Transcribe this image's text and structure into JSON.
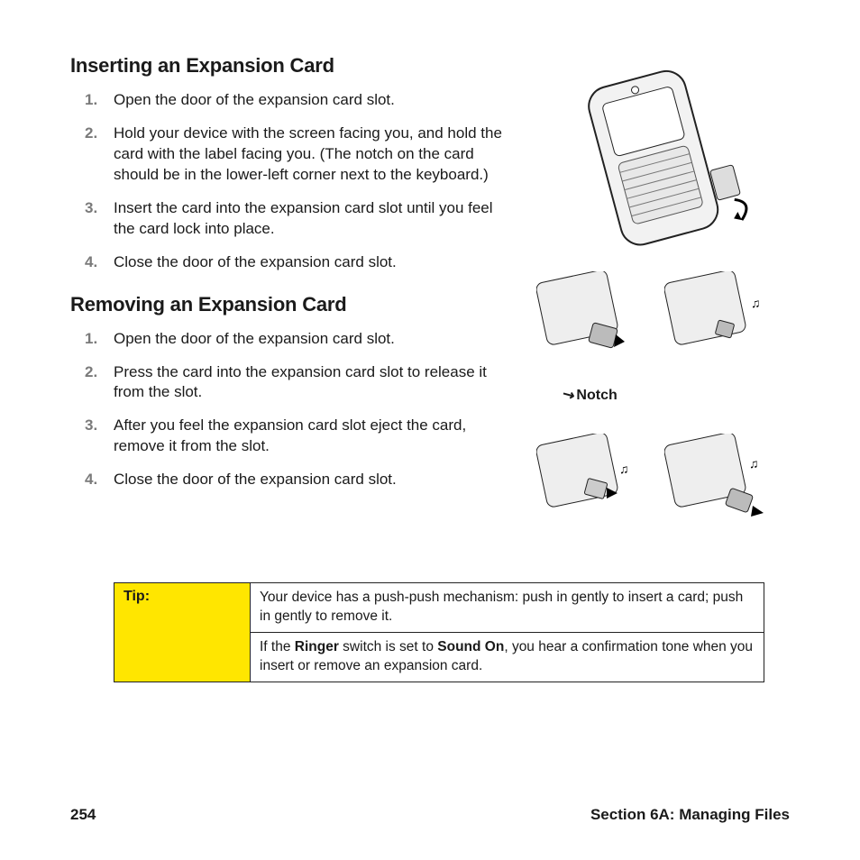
{
  "sections": {
    "inserting": {
      "heading": "Inserting an Expansion Card",
      "steps": [
        "Open the door of the expansion card slot.",
        "Hold your device with the screen facing you, and hold the card with the label facing you. (The notch on the card should be in the lower-left corner next to the keyboard.)",
        "Insert the card into the expansion card slot until you feel the card lock into place.",
        "Close the door of the expansion card slot."
      ]
    },
    "removing": {
      "heading": "Removing an Expansion Card",
      "steps": [
        "Open the door of the expansion card slot.",
        "Press the card into the expansion card slot to release it from the slot.",
        "After you feel the expansion card slot eject the card, remove it from the slot.",
        "Close the door of the expansion card slot."
      ]
    }
  },
  "figure_caption": "Notch",
  "tip": {
    "label": "Tip:",
    "rows": [
      {
        "plain": "Your device has a push-push mechanism: push in gently to insert a card; push in gently to remove it."
      },
      {
        "prefix": " If the ",
        "b1": "Ringer",
        "mid": " switch is set to ",
        "b2": "Sound On",
        "suffix": ", you hear a confirmation tone when you insert or remove an expansion card."
      }
    ]
  },
  "footer": {
    "page": "254",
    "section": "Section 6A: Managing Files"
  },
  "step_numbers": [
    "1.",
    "2.",
    "3.",
    "4."
  ]
}
